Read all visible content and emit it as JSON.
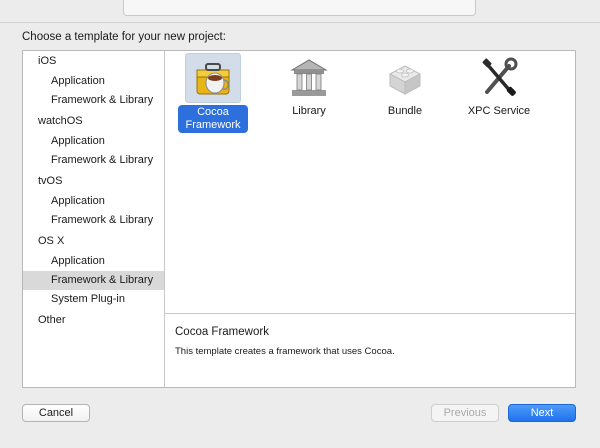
{
  "dialog": {
    "prompt": "Choose a template for your new project:"
  },
  "sidebar": {
    "rows": [
      {
        "label": "iOS",
        "kind": "section"
      },
      {
        "label": "Application",
        "kind": "item"
      },
      {
        "label": "Framework & Library",
        "kind": "item"
      },
      {
        "label": "watchOS",
        "kind": "section"
      },
      {
        "label": "Application",
        "kind": "item"
      },
      {
        "label": "Framework & Library",
        "kind": "item"
      },
      {
        "label": "tvOS",
        "kind": "section"
      },
      {
        "label": "Application",
        "kind": "item"
      },
      {
        "label": "Framework & Library",
        "kind": "item"
      },
      {
        "label": "OS X",
        "kind": "section"
      },
      {
        "label": "Application",
        "kind": "item"
      },
      {
        "label": "Framework & Library",
        "kind": "item",
        "selected": true
      },
      {
        "label": "System Plug-in",
        "kind": "item"
      },
      {
        "label": "Other",
        "kind": "section"
      }
    ]
  },
  "templates": [
    {
      "label": "Cocoa Framework",
      "icon": "toolbox-icon",
      "selected": true
    },
    {
      "label": "Library",
      "icon": "building-icon"
    },
    {
      "label": "Bundle",
      "icon": "lego-brick-icon"
    },
    {
      "label": "XPC Service",
      "icon": "tools-icon"
    }
  ],
  "description": {
    "title": "Cocoa Framework",
    "text": "This template creates a framework that uses Cocoa."
  },
  "buttons": {
    "cancel": "Cancel",
    "previous": "Previous",
    "next": "Next"
  },
  "colors": {
    "accent": "#2d6fdc",
    "selection_row": "#d9d9d9",
    "next_button": "#1f72ee"
  }
}
